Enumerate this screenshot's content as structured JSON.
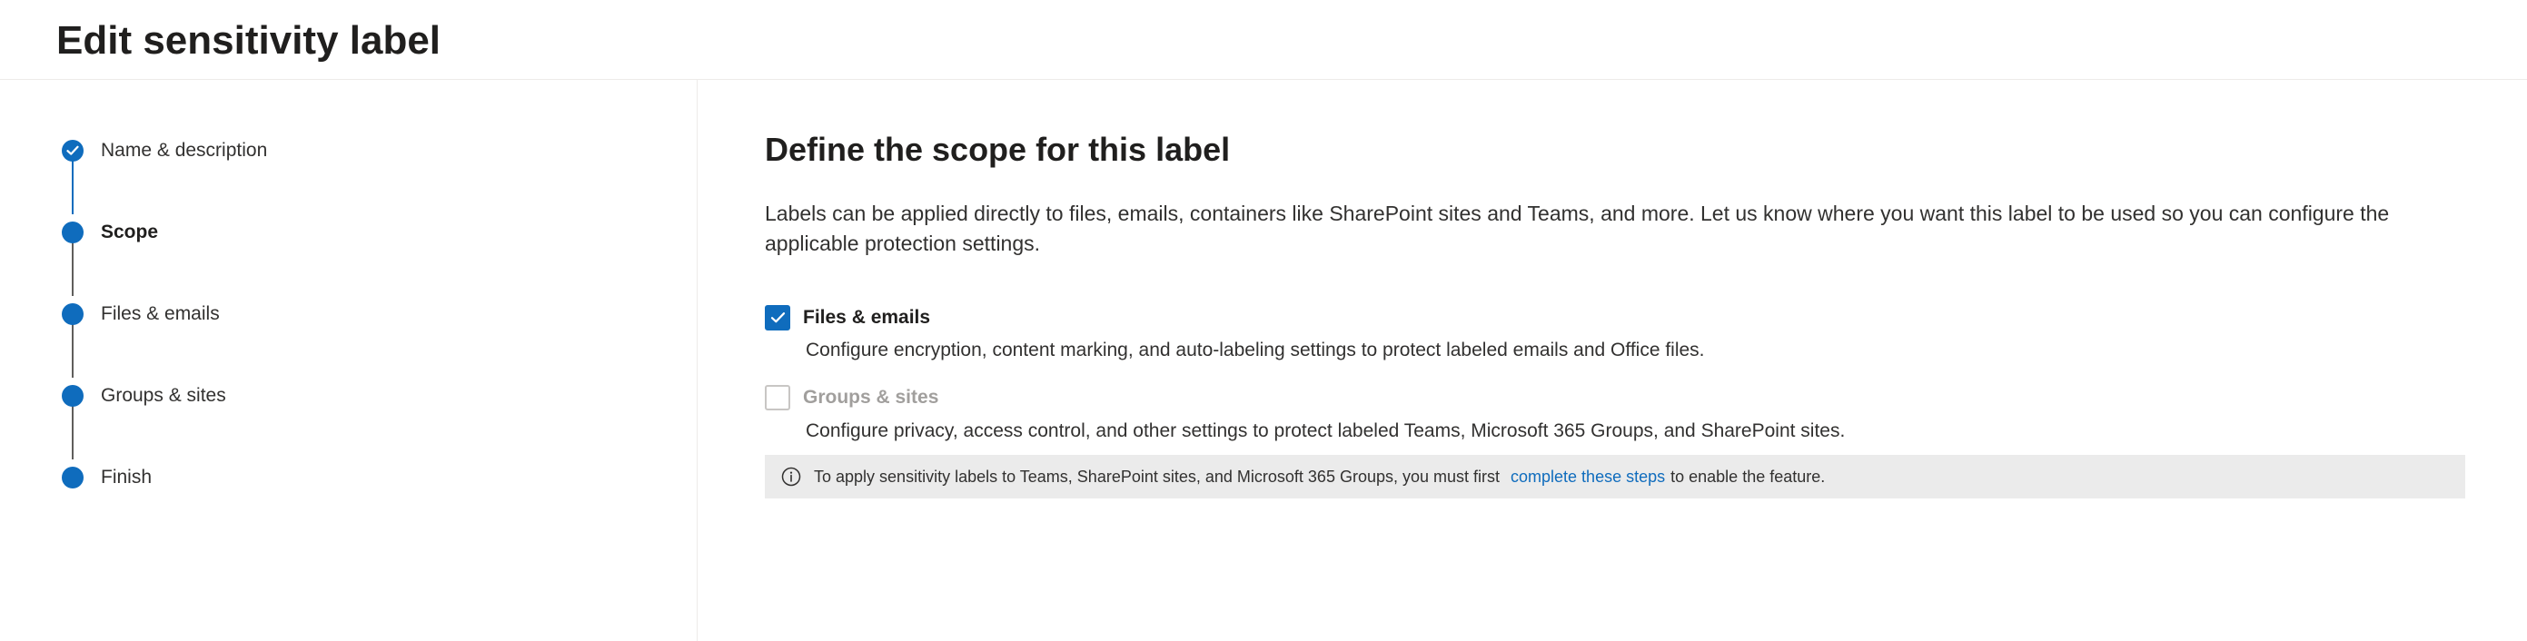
{
  "header": {
    "title": "Edit sensitivity label"
  },
  "sidebar": {
    "steps": [
      {
        "label": "Name & description",
        "state": "completed"
      },
      {
        "label": "Scope",
        "state": "current"
      },
      {
        "label": "Files & emails",
        "state": "pending"
      },
      {
        "label": "Groups & sites",
        "state": "pending"
      },
      {
        "label": "Finish",
        "state": "pending"
      }
    ]
  },
  "main": {
    "title": "Define the scope for this label",
    "description": "Labels can be applied directly to files, emails, containers like SharePoint sites and Teams, and more. Let us know where you want this label to be used so you can configure the applicable protection settings.",
    "options": [
      {
        "label": "Files & emails",
        "checked": true,
        "disabled": false,
        "description": "Configure encryption, content marking, and auto-labeling settings to protect labeled emails and Office files."
      },
      {
        "label": "Groups & sites",
        "checked": false,
        "disabled": true,
        "description": "Configure privacy, access control, and other settings to protect labeled Teams, Microsoft 365 Groups, and SharePoint sites."
      }
    ],
    "info_bar": {
      "icon": "info-icon",
      "text_before": "To apply sensitivity labels to Teams, SharePoint sites, and Microsoft 365 Groups, you must first",
      "link_text": "complete these steps",
      "text_after": "to enable the feature."
    }
  },
  "colors": {
    "accent": "#0f6cbd",
    "connector_pending": "#605e5c",
    "info_bar_bg": "#ebebeb",
    "disabled_text": "#a19f9d"
  }
}
